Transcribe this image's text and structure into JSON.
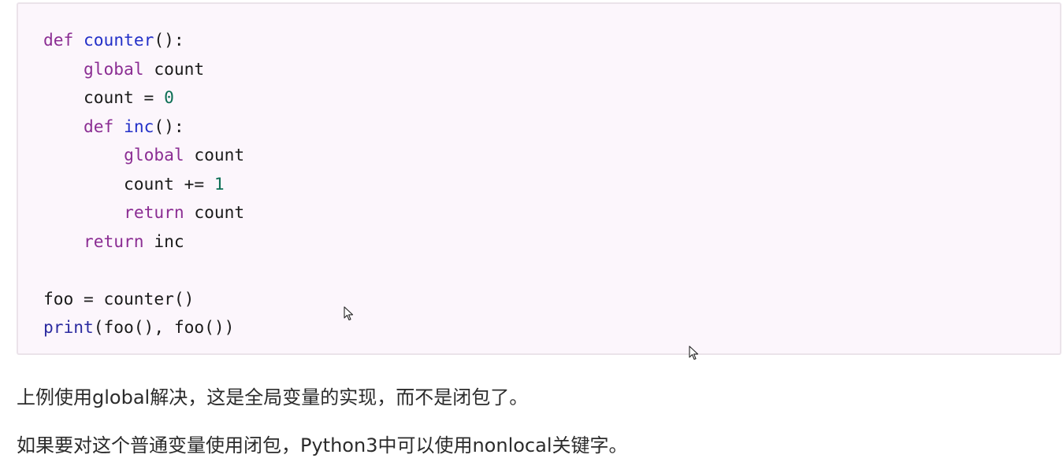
{
  "code_block": {
    "lines": [
      [
        {
          "t": "def",
          "c": "kw"
        },
        {
          "t": " ",
          "c": "plain"
        },
        {
          "t": "counter",
          "c": "fn"
        },
        {
          "t": "():",
          "c": "plain"
        }
      ],
      [
        {
          "t": "    ",
          "c": "plain"
        },
        {
          "t": "global",
          "c": "kw"
        },
        {
          "t": " count",
          "c": "plain"
        }
      ],
      [
        {
          "t": "    count = ",
          "c": "plain"
        },
        {
          "t": "0",
          "c": "num"
        }
      ],
      [
        {
          "t": "    ",
          "c": "plain"
        },
        {
          "t": "def",
          "c": "kw"
        },
        {
          "t": " ",
          "c": "plain"
        },
        {
          "t": "inc",
          "c": "fn"
        },
        {
          "t": "():",
          "c": "plain"
        }
      ],
      [
        {
          "t": "        ",
          "c": "plain"
        },
        {
          "t": "global",
          "c": "kw"
        },
        {
          "t": " count",
          "c": "plain"
        }
      ],
      [
        {
          "t": "        count += ",
          "c": "plain"
        },
        {
          "t": "1",
          "c": "num"
        }
      ],
      [
        {
          "t": "        ",
          "c": "plain"
        },
        {
          "t": "return",
          "c": "kw"
        },
        {
          "t": " count",
          "c": "plain"
        }
      ],
      [
        {
          "t": "    ",
          "c": "plain"
        },
        {
          "t": "return",
          "c": "kw"
        },
        {
          "t": " inc",
          "c": "plain"
        }
      ],
      [
        {
          "t": "",
          "c": "plain"
        }
      ],
      [
        {
          "t": "foo = counter()",
          "c": "plain"
        }
      ],
      [
        {
          "t": "print",
          "c": "builtin"
        },
        {
          "t": "(foo(), foo())",
          "c": "plain"
        }
      ]
    ]
  },
  "paragraphs": {
    "first": "上例使用global解决，这是全局变量的实现，而不是闭包了。",
    "second": "如果要对这个普通变量使用闭包，Python3中可以使用nonlocal关键字。"
  },
  "icons": {
    "cursor": "mouse-pointer-icon"
  },
  "colors": {
    "code_background": "#fcf6fc",
    "code_border": "#ebe3ea",
    "keyword": "#8b2d93",
    "function_name": "#2330c8",
    "number": "#0d6f55",
    "builtin": "#2b2ba0",
    "text": "#1a1a1a"
  }
}
